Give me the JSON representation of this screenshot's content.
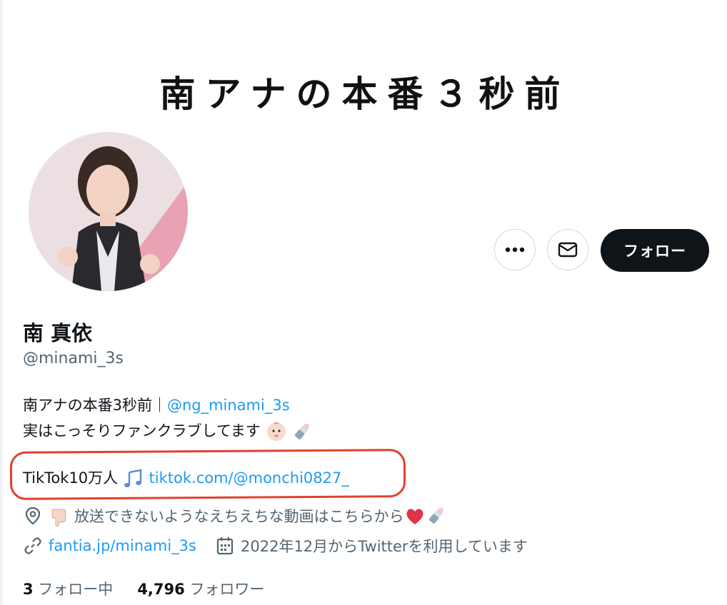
{
  "banner": {
    "title": "南アナの本番３秒前"
  },
  "actions": {
    "follow_label": "フォロー"
  },
  "profile": {
    "display_name": "南 真依",
    "handle": "@minami_3s",
    "bio": {
      "line1_text": "南アナの本番3秒前｜",
      "line1_link": "@ng_minami_3s",
      "line2_text": "実はこっそりファンクラブしてます",
      "line3_text": "TikTok10万人",
      "line3_link": "tiktok.com/@monchi0827_"
    },
    "location": "放送できないようなえちえちな動画はこちらから",
    "website": "fantia.jp/minami_3s",
    "joined": "2022年12月からTwitterを利用しています",
    "following_count": "3",
    "following_label": "フォロー中",
    "followers_count": "4,796",
    "followers_label": "フォロワー"
  },
  "icons": [
    "more-icon",
    "mail-icon",
    "location-pin-icon",
    "link-icon",
    "calendar-icon",
    "baby-emoji",
    "baby-bottle-emoji",
    "music-notes-emoji",
    "pointing-finger-emoji",
    "heart-emoji"
  ],
  "colors": {
    "accent": "#1d9bf0",
    "text": "#0f1419",
    "muted": "#536471",
    "follow_bg": "#0f1419",
    "highlight": "#e2412b"
  }
}
